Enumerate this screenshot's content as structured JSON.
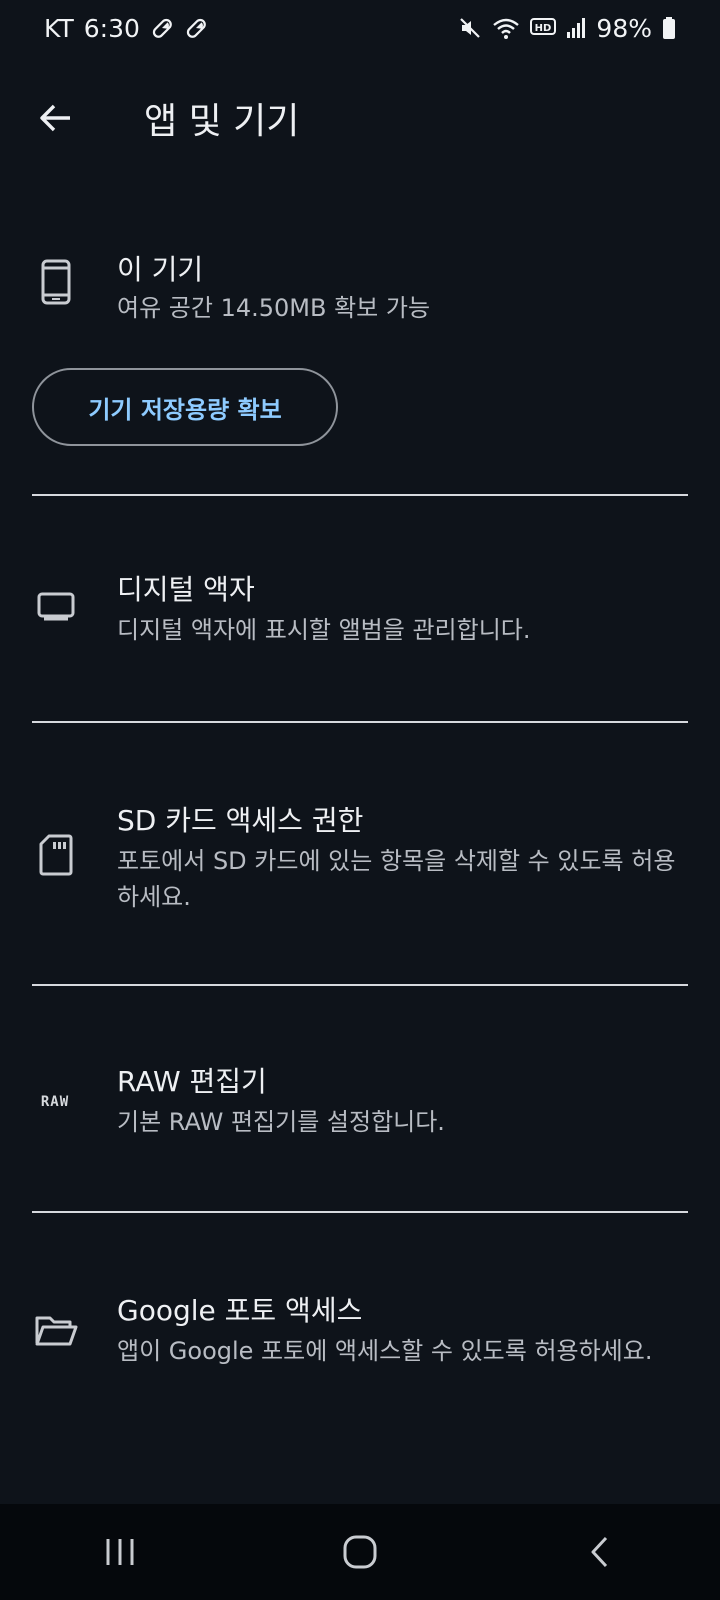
{
  "status": {
    "carrier": "KT",
    "time": "6:30",
    "battery": "98%",
    "icons": [
      "pill-icon",
      "pill-icon",
      "mute-icon",
      "wifi-icon",
      "hd-icon",
      "signal-icon",
      "battery-icon"
    ]
  },
  "appbar": {
    "title": "앱 및 기기",
    "back_icon": "arrow-back-icon"
  },
  "device": {
    "title": "이 기기",
    "desc": "여유 공간 14.50MB 확보 가능",
    "button": "기기 저장용량 확보",
    "icon": "phone-icon"
  },
  "items": [
    {
      "title": "디지털 액자",
      "desc": "디지털 액자에 표시할 앨범을 관리합니다.",
      "icon": "monitor-icon"
    },
    {
      "title": "SD 카드 액세스 권한",
      "desc": "포토에서 SD 카드에 있는 항목을 삭제할 수 있도록 허용하세요.",
      "icon": "sd-card-icon"
    },
    {
      "title": "RAW 편집기",
      "desc": "기본 RAW 편집기를 설정합니다.",
      "icon_text": "RAW"
    },
    {
      "title": "Google 포토 액세스",
      "desc": "앱이 Google 포토에 액세스할 수 있도록 허용하세요.",
      "icon": "folder-open-icon"
    }
  ],
  "colors": {
    "background": "#0e131a",
    "accent": "#8ecbff",
    "divider": "#d6d9de",
    "navbar": "#05080c"
  }
}
